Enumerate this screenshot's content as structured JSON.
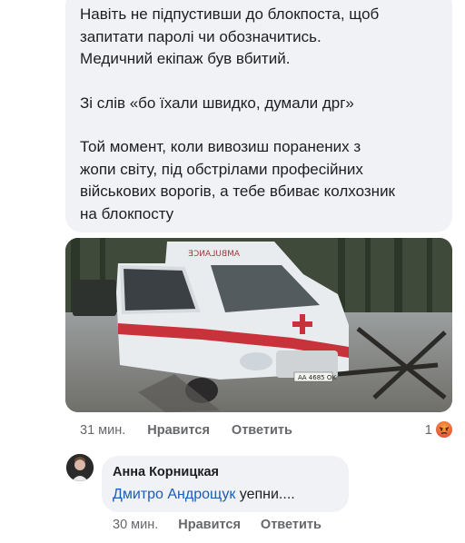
{
  "post": {
    "paragraphs": [
      "Навіть не підпустивши до блокпоста, щоб\nзапитати паролі чи обозначитись.\nМедичний екіпаж був вбитий.",
      "Зі слів «бо їхали швидко, думали дрг»",
      "Той момент, коли вивозиш поранених з\nжопи світу, під обстрілами професійних\nвійськових ворогів, а тебе вбиває колхозник\nна блокпосту"
    ],
    "photo_alt": "ambulance-photo",
    "ambulance_label": "AMBULANCE",
    "plate": "АА 4685 ОК",
    "time": "31 мин.",
    "like": "Нравится",
    "reply": "Ответить",
    "reaction_count": "1",
    "reaction_icon": "angry-reaction-icon"
  },
  "reply_comment": {
    "author": "Анна Корницкая",
    "mention": "Дмитро Андрощук",
    "text": " уепни....",
    "time": "30 мин.",
    "like": "Нравится",
    "reply": "Ответить"
  },
  "colors": {
    "bubble": "#f0f2f5",
    "mention": "#1d5bb8",
    "meta": "#65676b"
  }
}
